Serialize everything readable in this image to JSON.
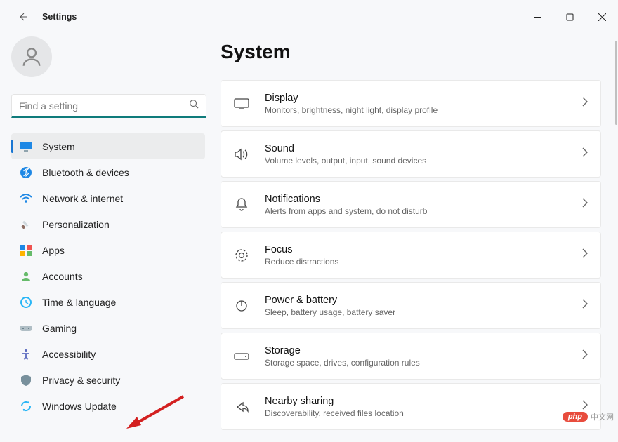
{
  "window": {
    "title": "Settings"
  },
  "search": {
    "placeholder": "Find a setting"
  },
  "sidebar": {
    "items": [
      {
        "label": "System"
      },
      {
        "label": "Bluetooth & devices"
      },
      {
        "label": "Network & internet"
      },
      {
        "label": "Personalization"
      },
      {
        "label": "Apps"
      },
      {
        "label": "Accounts"
      },
      {
        "label": "Time & language"
      },
      {
        "label": "Gaming"
      },
      {
        "label": "Accessibility"
      },
      {
        "label": "Privacy & security"
      },
      {
        "label": "Windows Update"
      }
    ]
  },
  "page": {
    "heading": "System",
    "cards": [
      {
        "title": "Display",
        "subtitle": "Monitors, brightness, night light, display profile"
      },
      {
        "title": "Sound",
        "subtitle": "Volume levels, output, input, sound devices"
      },
      {
        "title": "Notifications",
        "subtitle": "Alerts from apps and system, do not disturb"
      },
      {
        "title": "Focus",
        "subtitle": "Reduce distractions"
      },
      {
        "title": "Power & battery",
        "subtitle": "Sleep, battery usage, battery saver"
      },
      {
        "title": "Storage",
        "subtitle": "Storage space, drives, configuration rules"
      },
      {
        "title": "Nearby sharing",
        "subtitle": "Discoverability, received files location"
      }
    ]
  },
  "watermark": {
    "badge": "php",
    "text": "中文网"
  }
}
